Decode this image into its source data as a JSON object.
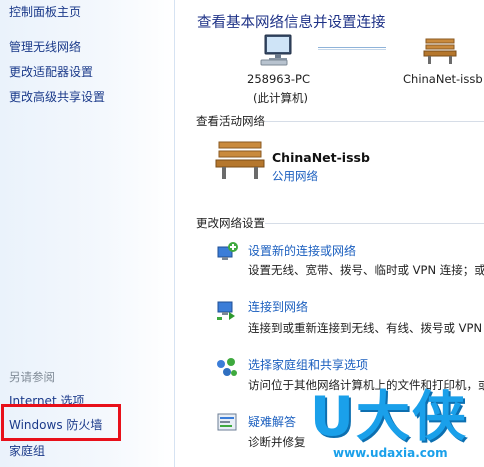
{
  "sidebar": {
    "home_link": "控制面板主页",
    "links": [
      "管理无线网络",
      "更改适配器设置",
      "更改高级共享设置"
    ],
    "see_also_header": "另请参阅",
    "see_also": [
      "Internet 选项",
      "Windows 防火墙",
      "家庭组"
    ],
    "highlight_color": "#e8101a"
  },
  "main": {
    "title": "查看基本网络信息并设置连接",
    "map": {
      "computer_name": "258963-PC",
      "computer_sub": "(此计算机)",
      "network_name": "ChinaNet-issb"
    },
    "active_section": "查看活动网络",
    "active_network": {
      "name": "ChinaNet-issb",
      "type": "公用网络"
    },
    "settings_section": "更改网络设置",
    "tasks": [
      {
        "link": "设置新的连接或网络",
        "desc": "设置无线、宽带、拨号、临时或 VPN 连接；或"
      },
      {
        "link": "连接到网络",
        "desc": "连接到或重新连接到无线、有线、拨号或 VPN"
      },
      {
        "link": "选择家庭组和共享选项",
        "desc": "访问位于其他网络计算机上的文件和打印机，或"
      },
      {
        "link": "疑难解答",
        "desc": "诊断并修复"
      }
    ]
  },
  "watermark": {
    "brand": "U大侠",
    "url": "www.udaxia.com",
    "color": "#1aa0ea"
  }
}
